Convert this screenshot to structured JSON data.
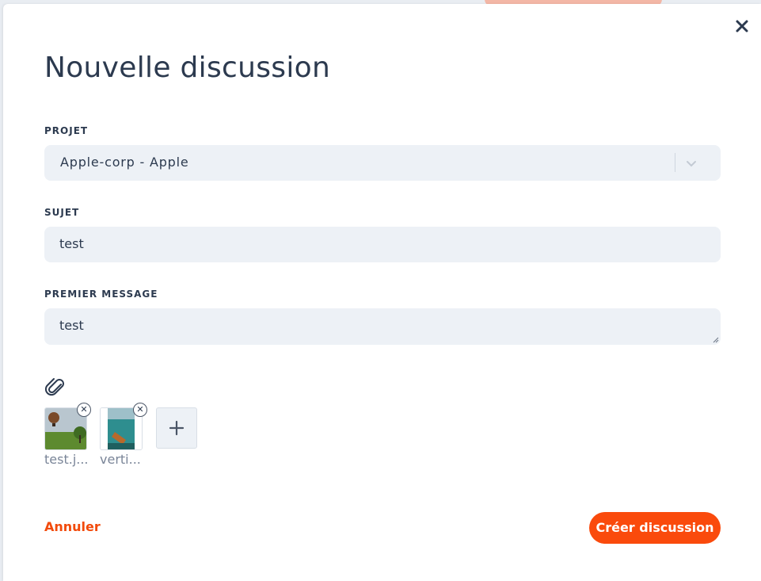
{
  "modal": {
    "title": "Nouvelle discussion",
    "close_icon": "close-icon"
  },
  "form": {
    "project": {
      "label": "PROJET",
      "value": "Apple-corp - Apple",
      "icon": "chevron-down-icon"
    },
    "subject": {
      "label": "SUJET",
      "value": "test"
    },
    "message": {
      "label": "PREMIER MESSAGE",
      "value": "test"
    },
    "attach_icon": "paperclip-icon"
  },
  "attachments": [
    {
      "name": "test.j..."
    },
    {
      "name": "verti..."
    }
  ],
  "actions": {
    "cancel_label": "Annuler",
    "create_label": "Créer discussion"
  },
  "colors": {
    "accent": "#fa4a0c",
    "text": "#2c3a4f",
    "field_bg": "#edf1f6"
  }
}
